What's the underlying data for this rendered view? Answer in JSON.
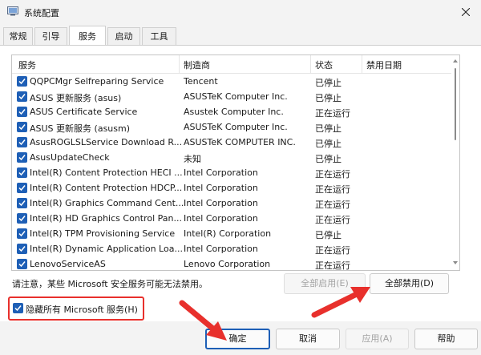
{
  "window": {
    "title": "系统配置"
  },
  "tabs": [
    {
      "label": "常规",
      "active": false
    },
    {
      "label": "引导",
      "active": false
    },
    {
      "label": "服务",
      "active": true
    },
    {
      "label": "启动",
      "active": false
    },
    {
      "label": "工具",
      "active": false
    }
  ],
  "columns": {
    "service": "服务",
    "manufacturer": "制造商",
    "status": "状态",
    "disabled_date": "禁用日期"
  },
  "services": [
    {
      "name": "QQPCMgr Selfreparing Service",
      "manufacturer": "Tencent",
      "status": "已停止"
    },
    {
      "name": "ASUS 更新服务 (asus)",
      "manufacturer": "ASUSTeK Computer Inc.",
      "status": "已停止"
    },
    {
      "name": "ASUS Certificate Service",
      "manufacturer": "Asustek Computer Inc.",
      "status": "正在运行"
    },
    {
      "name": "ASUS 更新服务 (asusm)",
      "manufacturer": "ASUSTeK Computer Inc.",
      "status": "已停止"
    },
    {
      "name": "AsusROGLSLService Download R...",
      "manufacturer": "ASUSTeK COMPUTER INC.",
      "status": "已停止"
    },
    {
      "name": "AsusUpdateCheck",
      "manufacturer": "未知",
      "status": "已停止"
    },
    {
      "name": "Intel(R) Content Protection HECI ...",
      "manufacturer": "Intel Corporation",
      "status": "正在运行"
    },
    {
      "name": "Intel(R) Content Protection HDCP...",
      "manufacturer": "Intel Corporation",
      "status": "正在运行"
    },
    {
      "name": "Intel(R) Graphics Command Cent...",
      "manufacturer": "Intel Corporation",
      "status": "正在运行"
    },
    {
      "name": "Intel(R) HD Graphics Control Pan...",
      "manufacturer": "Intel Corporation",
      "status": "正在运行"
    },
    {
      "name": "Intel(R) TPM Provisioning Service",
      "manufacturer": "Intel(R) Corporation",
      "status": "已停止"
    },
    {
      "name": "Intel(R) Dynamic Application Loa...",
      "manufacturer": "Intel Corporation",
      "status": "正在运行"
    },
    {
      "name": "LenovoServiceAS",
      "manufacturer": "Lenovo Corporation",
      "status": "正在运行"
    }
  ],
  "note": "请注意，某些 Microsoft 安全服务可能无法禁用。",
  "buttons": {
    "enable_all": "全部启用(E)",
    "disable_all": "全部禁用(D)",
    "ok": "确定",
    "cancel": "取消",
    "apply": "应用(A)",
    "help": "帮助"
  },
  "hide_microsoft": {
    "label": "隐藏所有 Microsoft 服务(H)",
    "checked": true
  },
  "colors": {
    "accent": "#1e5fb6",
    "annotation": "#e8302c"
  }
}
